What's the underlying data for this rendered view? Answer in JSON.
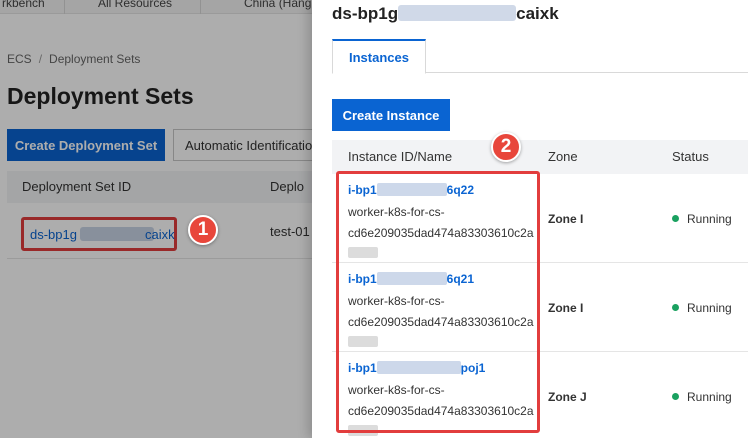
{
  "topbar": {
    "left": "rkbench",
    "resources": "All Resources",
    "region": "China (Hang"
  },
  "breadcrumb": {
    "root": "ECS",
    "separator": "/",
    "current": "Deployment Sets"
  },
  "page": {
    "title": "Deployment Sets",
    "create_button": "Create Deployment Set",
    "auto_id_button": "Automatic Identification",
    "table": {
      "columns": [
        "Deployment Set ID",
        "Deplo"
      ],
      "rows": [
        {
          "id_prefix": "ds-bp1g",
          "id_suffix": "caixk",
          "name": "test-01"
        }
      ]
    }
  },
  "badges": {
    "one": "1",
    "two": "2"
  },
  "drawer": {
    "title_prefix": "ds-bp1g",
    "title_suffix": "caixk",
    "tab": "Instances",
    "create_button": "Create Instance",
    "columns": {
      "id_name": "Instance ID/Name",
      "zone": "Zone",
      "status": "Status"
    },
    "instances": [
      {
        "id_prefix": "i-bp1",
        "id_suffix": "6q22",
        "name_line1": "worker-k8s-for-cs-",
        "name_line2": "cd6e209035dad474a83303610c2a",
        "zone": "Zone I",
        "status": "Running"
      },
      {
        "id_prefix": "i-bp1",
        "id_suffix": "6q21",
        "name_line1": "worker-k8s-for-cs-",
        "name_line2": "cd6e209035dad474a83303610c2a",
        "zone": "Zone I",
        "status": "Running"
      },
      {
        "id_prefix": "i-bp1",
        "id_suffix": "poj1",
        "name_line1": "worker-k8s-for-cs-",
        "name_line2": "cd6e209035dad474a83303610c2a",
        "zone": "Zone J",
        "status": "Running"
      }
    ]
  },
  "colors": {
    "primary": "#0a64d2",
    "highlight": "#e23d3d",
    "running": "#1aa160"
  }
}
